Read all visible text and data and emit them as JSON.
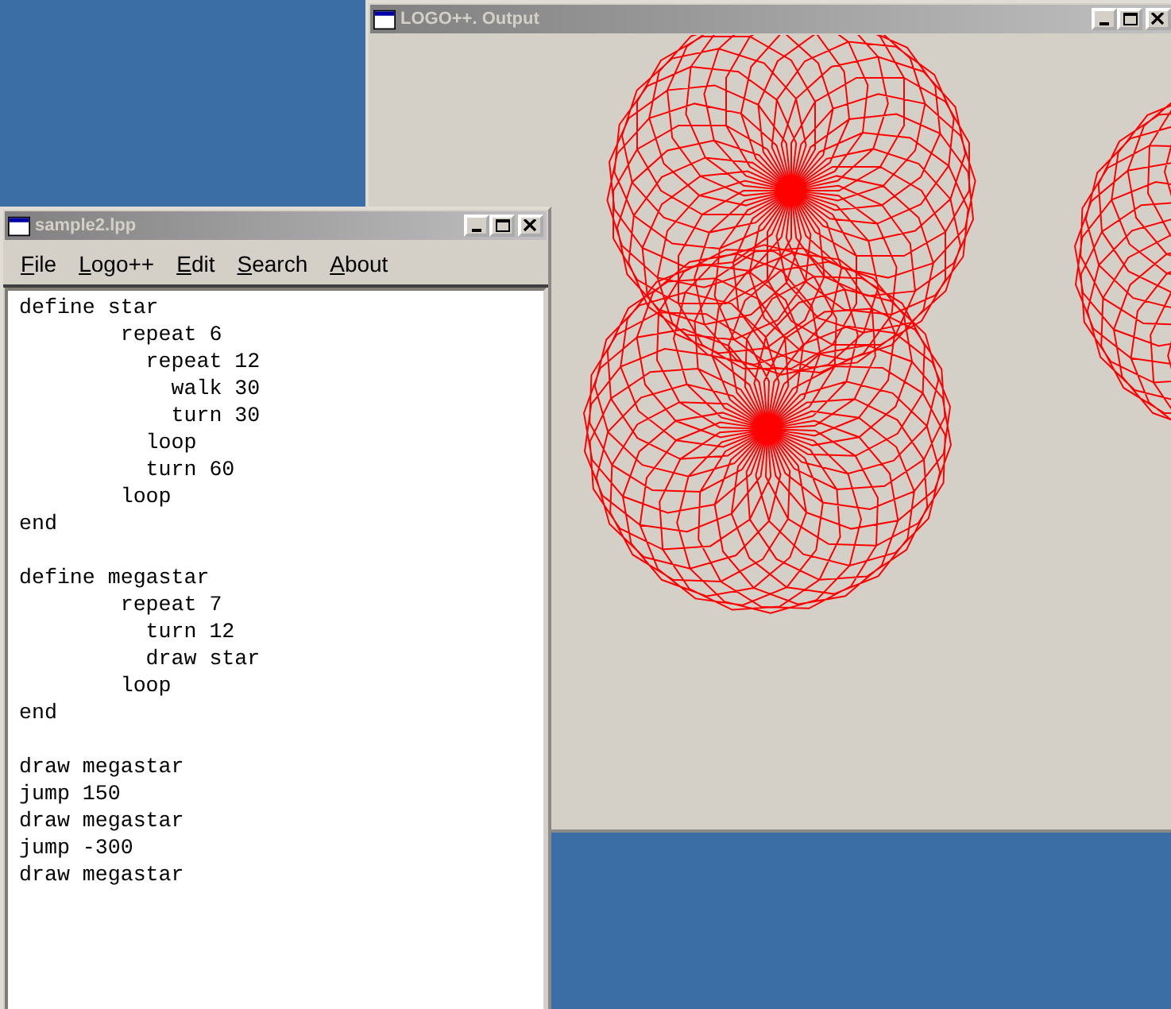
{
  "output_window": {
    "title": "LOGO++. Output"
  },
  "editor_window": {
    "title": "sample2.lpp",
    "menu": [
      "File",
      "Logo++",
      "Edit",
      "Search",
      "About"
    ],
    "code": "define star\n        repeat 6\n          repeat 12\n            walk 30\n            turn 30\n          loop\n          turn 60\n        loop\nend\n\ndefine megastar\n        repeat 7\n          turn 12\n          draw star\n        loop\nend\n\ndraw megastar\njump 150\ndraw megastar\njump -300\ndraw megastar"
  }
}
